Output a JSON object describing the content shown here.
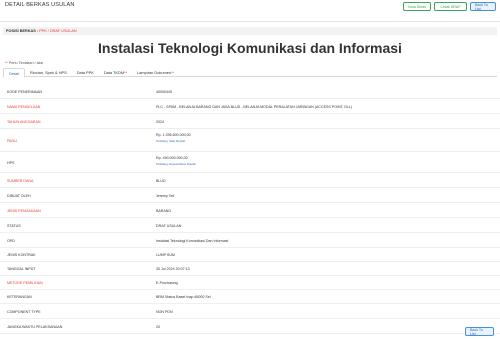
{
  "header": {
    "title": "DETAIL BERKAS USULAN",
    "actions": {
      "nota_dinas": "Nota Dinas",
      "cetak_drap": "Cetak DRAP",
      "back_to_list": "Back To List"
    }
  },
  "breadcrumb": {
    "label": "POSISI BERKAS :",
    "path": "PPK / DRAF USULAN"
  },
  "heading": "Instalasi Teknologi Komunikasi dan Informasi",
  "required_note": {
    "star": "**",
    "text": "Perlu Tindakan / aksi"
  },
  "tabs": [
    {
      "label": "Detail",
      "star": ""
    },
    {
      "label": "Rincian, Spek & HPS",
      "star": ""
    },
    {
      "label": "Data PPK",
      "star": ""
    },
    {
      "label": "Data TKDM",
      "star": "**"
    },
    {
      "label": "Lampiran Dokumen",
      "star": "**"
    }
  ],
  "details": [
    {
      "label": "KODE PENERIMAAN",
      "value": "40000445",
      "red": false
    },
    {
      "label": "NAMA PENGELUAN",
      "value": "PLC - SPAM - BELANJA BARANG DAN JASA BLUD - BELANJA MODAL PERALATAN JARINGAN (ACCESS POINT, DLL)",
      "red": true
    },
    {
      "label": "TAHUN ANGGARAN",
      "value": "2024",
      "red": true
    },
    {
      "label": "PAGU",
      "value": "Rp. 1.395.600.000,00",
      "sub": "Terbilang: Satu Rupiah",
      "red": true
    },
    {
      "label": "HPS",
      "value": "Rp. 490.000.000,00",
      "sub": "Terbilang: Empat Ratus Rupiah",
      "red": false
    },
    {
      "label": "SUMBER DANA",
      "value": "BLUD",
      "red": true
    },
    {
      "label": "DIBUAT OLEH",
      "value": "Jeremy Teti",
      "red": false
    },
    {
      "label": "JENIS PENGADAAN",
      "value": "BARANG",
      "red": true
    },
    {
      "label": "STATUS",
      "value": "DRAF USULAN",
      "red": false
    },
    {
      "label": "OPD",
      "value": "Instalasi Teknologi Komunikasi Dan Informasi",
      "red": false
    },
    {
      "label": "JENIS KONTRAK",
      "value": "LUMP SUM",
      "red": false
    },
    {
      "label": "TANGGAL INPUT",
      "value": "30 Jul 2024 20:07:13",
      "red": false
    },
    {
      "label": "METODE PEMILIHAN",
      "value": "E-Purchasing",
      "red": true
    },
    {
      "label": "KETERANGAN",
      "value": "BRM Status Baset Inap #5000 Sel",
      "red": false
    },
    {
      "label": "COMPONENT TYPE",
      "value": "NON PDN",
      "red": false
    },
    {
      "label": "JANGKA WAKTU PELAKSANAAN",
      "value": "20",
      "red": false
    }
  ],
  "footer": {
    "back_to_list": "Back To List"
  }
}
